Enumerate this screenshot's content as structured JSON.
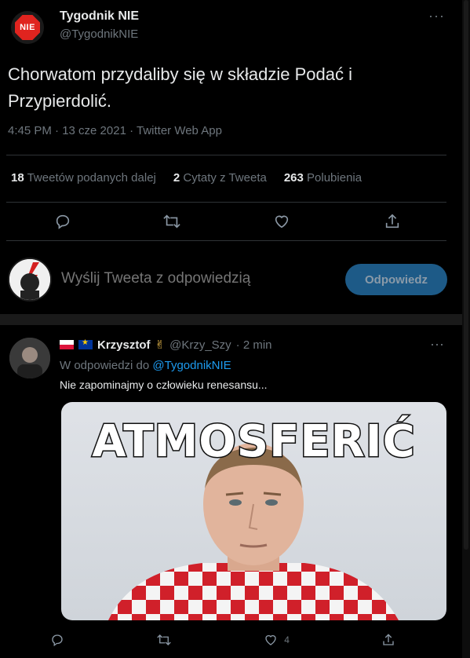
{
  "main_tweet": {
    "author": {
      "name": "Tygodnik NIE",
      "handle": "@TygodnikNIE",
      "logo_text": "NIE"
    },
    "text_lines": [
      "Chorwatom przydaliby się w składzie Podać i",
      "Przypierdolić."
    ],
    "meta": "4:45 PM · 13 cze 2021 · Twitter Web App",
    "stats": {
      "retweets_count": "18",
      "retweets_label": "Tweetów podanych dalej",
      "quotes_count": "2",
      "quotes_label": "Cytaty z Tweeta",
      "likes_count": "263",
      "likes_label": "Polubienia"
    },
    "more_label": "···"
  },
  "composer": {
    "placeholder": "Wyślij Tweeta z odpowiedzią",
    "button_label": "Odpowiedz"
  },
  "reply": {
    "author_name": "Krzysztof",
    "author_emoji": "✌",
    "handle": "@Krzy_Szy",
    "time": "· 2 min",
    "replying_prefix": "W odpowiedzi do",
    "replying_to": "@TygodnikNIE",
    "text": "Nie zapominajmy o człowieku renesansu...",
    "meme_caption": "ATMOSFERIĆ",
    "likes_count": "4",
    "more_label": "···"
  },
  "colors": {
    "accent": "#1d9bf0",
    "background": "#000000",
    "logo_red": "#e0241f",
    "button_disabled": "#1d5a87"
  },
  "icons": [
    "reply-icon",
    "retweet-icon",
    "like-icon",
    "share-icon"
  ]
}
